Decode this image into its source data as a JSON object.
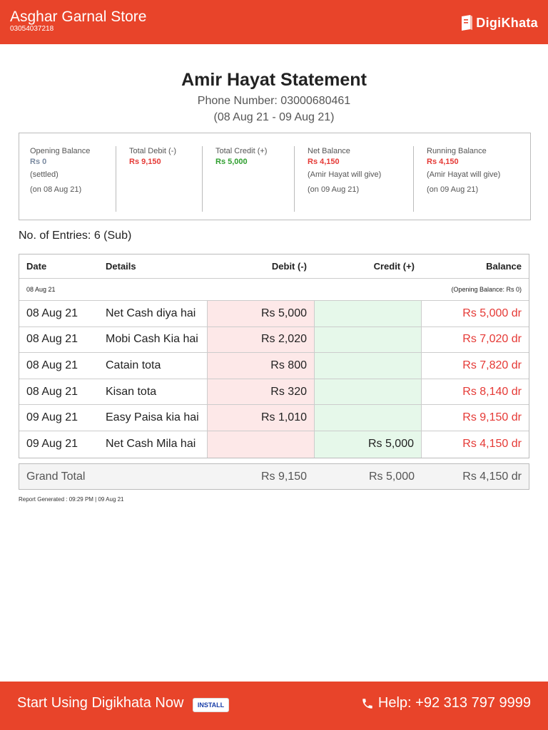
{
  "header": {
    "store_name": "Asghar Garnal Store",
    "store_phone": "03054037218",
    "logo_text": "DigiKhata",
    "logo_icon": "book-icon"
  },
  "statement": {
    "title": "Amir Hayat Statement",
    "phone": "Phone Number: 03000680461",
    "range": "(08 Aug 21 - 09 Aug 21)"
  },
  "summary": {
    "opening": {
      "label": "Opening Balance",
      "value": "Rs 0",
      "note": "(settled)",
      "date": "(on 08 Aug 21)"
    },
    "debit": {
      "label": "Total Debit (-)",
      "value": "Rs 9,150"
    },
    "credit": {
      "label": "Total Credit (+)",
      "value": "Rs 5,000"
    },
    "net": {
      "label": "Net Balance",
      "value": "Rs 4,150",
      "note": "(Amir Hayat will give)",
      "date": "(on 09 Aug 21)"
    },
    "running": {
      "label": "Running Balance",
      "value": "Rs 4,150",
      "note": "(Amir Hayat will give)",
      "date": "(on 09 Aug 21)"
    }
  },
  "entries_text": "No. of Entries: 6 (Sub)",
  "table": {
    "headers": {
      "date": "Date",
      "details": "Details",
      "debit": "Debit (-)",
      "credit": "Credit (+)",
      "balance": "Balance"
    },
    "group_date": "08 Aug 21",
    "opening_note": "(Opening Balance: Rs 0)",
    "rows": [
      {
        "date": "08 Aug 21",
        "details": "Net Cash diya hai",
        "debit": "Rs 5,000",
        "credit": "",
        "balance": "Rs 5,000 dr"
      },
      {
        "date": "08 Aug 21",
        "details": "Mobi Cash Kia hai",
        "debit": "Rs 2,020",
        "credit": "",
        "balance": "Rs 7,020 dr"
      },
      {
        "date": "08 Aug 21",
        "details": "Catain tota",
        "debit": "Rs 800",
        "credit": "",
        "balance": "Rs 7,820 dr"
      },
      {
        "date": "08 Aug 21",
        "details": "Kisan tota",
        "debit": "Rs 320",
        "credit": "",
        "balance": "Rs 8,140 dr"
      },
      {
        "date": "09 Aug 21",
        "details": "Easy Paisa kia hai",
        "debit": "Rs 1,010",
        "credit": "",
        "balance": "Rs 9,150 dr"
      },
      {
        "date": "09 Aug 21",
        "details": "Net Cash Mila hai",
        "debit": "",
        "credit": "Rs 5,000",
        "balance": "Rs 4,150 dr"
      }
    ]
  },
  "grand_total": {
    "label": "Grand Total",
    "debit": "Rs 9,150",
    "credit": "Rs 5,000",
    "balance": "Rs 4,150 dr"
  },
  "generated": "Report Generated : 09:29 PM | 09 Aug 21",
  "footer": {
    "cta": "Start Using Digikhata Now",
    "install": "INSTALL",
    "help": "Help: +92 313 797 9999"
  },
  "colors": {
    "brand": "#e8442a",
    "debit": "#e53935",
    "credit": "#2e9e2e",
    "debit_bg": "#fde8e8",
    "credit_bg": "#e6f8ea"
  }
}
